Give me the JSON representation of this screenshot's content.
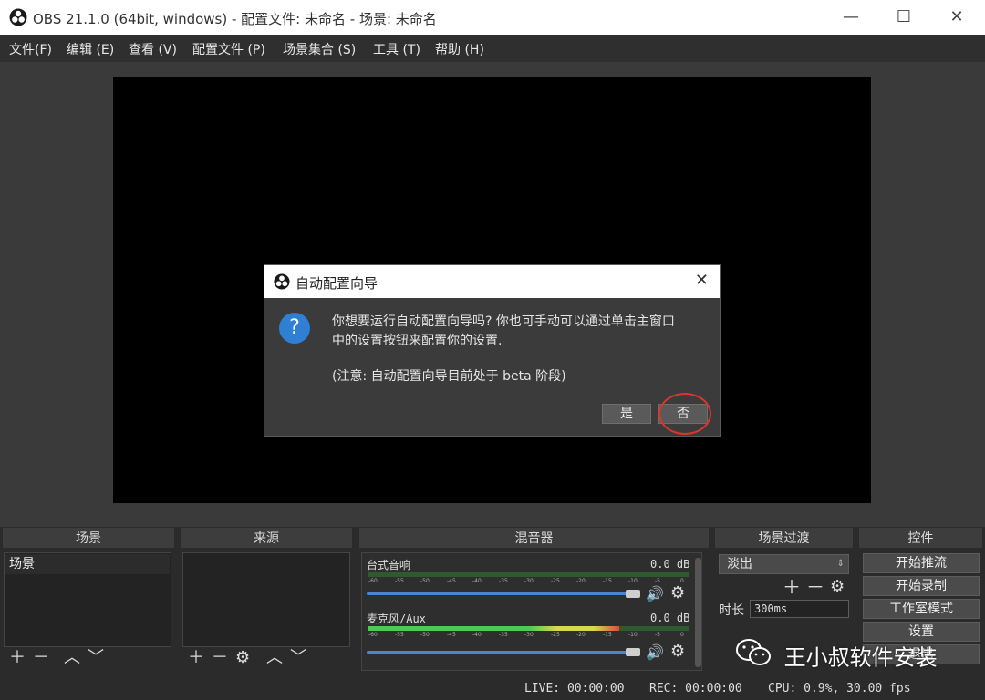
{
  "window": {
    "title": "OBS 21.1.0 (64bit, windows) - 配置文件: 未命名 - 场景: 未命名"
  },
  "menu": [
    "文件(F)",
    "编辑 (E)",
    "查看 (V)",
    "配置文件 (P)",
    "场景集合 (S)",
    "工具 (T)",
    "帮助 (H)"
  ],
  "panels": {
    "scenes": {
      "header": "场景",
      "items": [
        "场景"
      ]
    },
    "sources": {
      "header": "来源"
    },
    "mixer": {
      "header": "混音器",
      "channels": [
        {
          "name": "台式音响",
          "db": "0.0 dB",
          "level": 0.0
        },
        {
          "name": "麦克风/Aux",
          "db": "0.0 dB",
          "level": 0.78
        }
      ],
      "ticks": [
        "-60",
        "-55",
        "-50",
        "-45",
        "-40",
        "-35",
        "-30",
        "-25",
        "-20",
        "-15",
        "-10",
        "-5",
        "0"
      ]
    },
    "transitions": {
      "header": "场景过渡",
      "selected": "淡出",
      "duration_label": "时长",
      "duration_value": "300ms"
    },
    "controls": {
      "header": "控件",
      "buttons": [
        "开始推流",
        "开始录制",
        "工作室模式",
        "设置",
        "退出"
      ]
    }
  },
  "status": {
    "live": "LIVE: 00:00:00",
    "rec": "REC: 00:00:00",
    "cpu": "CPU: 0.9%, 30.00 fps"
  },
  "dialog": {
    "title": "自动配置向导",
    "line1": "你想要运行自动配置向导吗? 你也可手动可以通过单击主窗口",
    "line2": "中的设置按钮来配置你的设置.",
    "note": "(注意: 自动配置向导目前处于 beta 阶段)",
    "yes": "是",
    "no": "否"
  },
  "watermark": "王小叔软件安装",
  "colors": {
    "accent": "#4a86c8",
    "highlight_circle": "#d9362c",
    "meter_green": "#4fc85a",
    "meter_yellow": "#d8d84a",
    "meter_red": "#d84a4a"
  }
}
